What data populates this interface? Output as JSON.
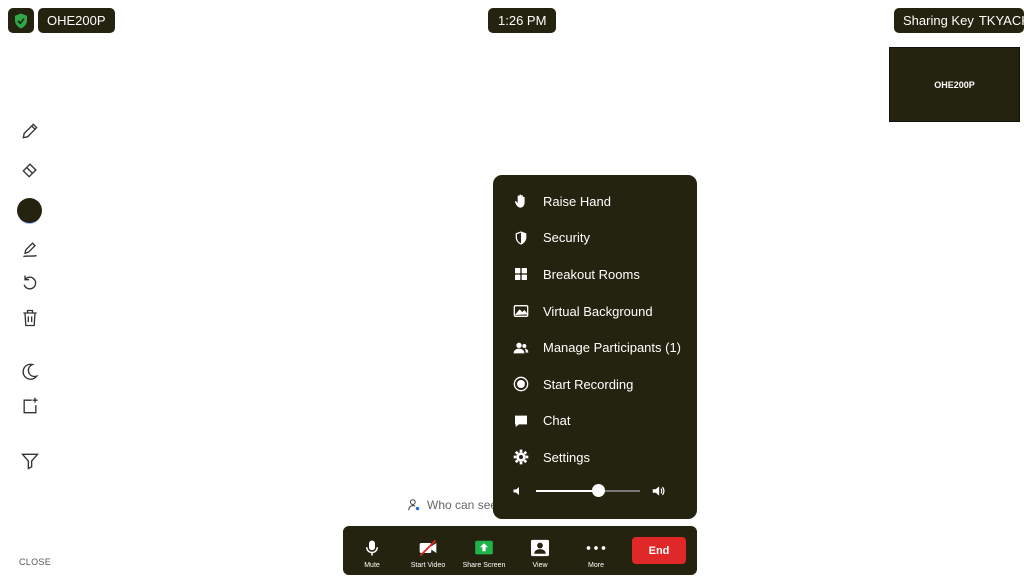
{
  "top_bar": {
    "meeting_id": "OHE200P",
    "clock": "1:26 PM",
    "sharing_key_label": "Sharing Key",
    "sharing_key_value": "TKYACK"
  },
  "self_view": {
    "name": "OHE200P"
  },
  "annotation_tools": {
    "icons": [
      "pencil-icon",
      "eraser-icon",
      "color-swatch",
      "highlighter-icon",
      "undo-icon",
      "trash-icon",
      "moon-icon",
      "add-page-icon",
      "filter-icon"
    ],
    "current_color": "#23230f"
  },
  "close_label": "CLOSE",
  "who_can_see": "Who can see",
  "more_menu": {
    "items": [
      {
        "label": "Raise Hand",
        "icon": "hand-icon"
      },
      {
        "label": "Security",
        "icon": "shield-icon"
      },
      {
        "label": "Breakout Rooms",
        "icon": "grid-icon"
      },
      {
        "label": "Virtual Background",
        "icon": "image-icon"
      },
      {
        "label": "Manage Participants (1)",
        "icon": "participants-icon"
      },
      {
        "label": "Start Recording",
        "icon": "record-icon"
      },
      {
        "label": "Chat",
        "icon": "chat-icon"
      },
      {
        "label": "Settings",
        "icon": "gear-icon"
      }
    ],
    "volume_level": 0.6
  },
  "toolbar": {
    "mute": "Mute",
    "start_video": "Start Video",
    "share_screen": "Share Screen",
    "view": "View",
    "more": "More",
    "end": "End"
  },
  "colors": {
    "panel": "#23230f",
    "end_button": "#e02828",
    "share_green": "#21b24b",
    "security_green": "#2ea84a"
  }
}
